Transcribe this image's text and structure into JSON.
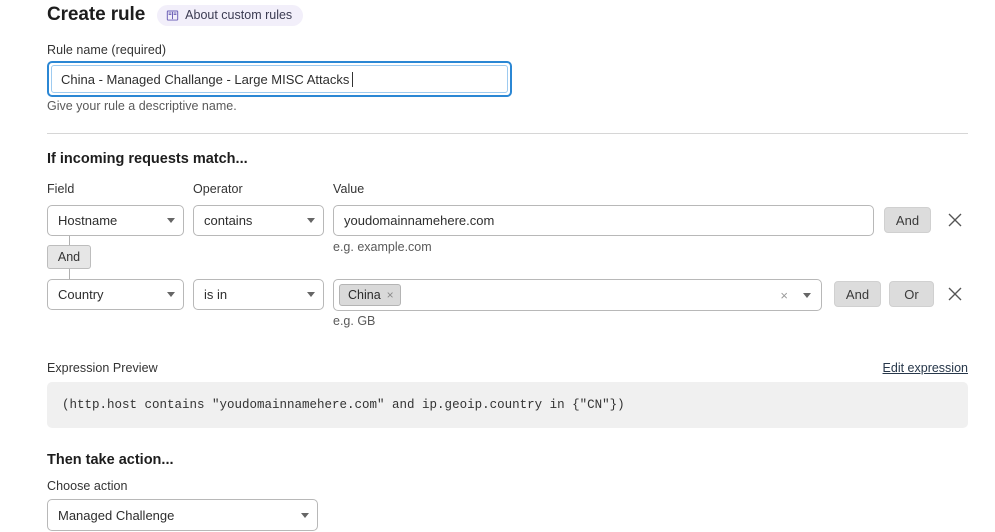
{
  "header": {
    "title": "Create rule",
    "about_pill_label": "About custom rules",
    "about_pill_icon": "book-icon",
    "pill_bg": "#f2effa",
    "pill_icon_color": "#6b5fb5"
  },
  "rule_name": {
    "label": "Rule name (required)",
    "value": "China - Managed Challange - Large MISC Attacks",
    "placeholder": "Rule name",
    "help": "Give your rule a descriptive name.",
    "focus_color": "#2b87d4"
  },
  "match_section": {
    "heading": "If incoming requests match...",
    "columns": {
      "field": "Field",
      "operator": "Operator",
      "value": "Value"
    },
    "connector_label": "And",
    "rows": [
      {
        "field": "Hostname",
        "operator": "contains",
        "value": "youdomainnamehere.com",
        "value_hint": "e.g. example.com",
        "and_label": "And",
        "or_label": null,
        "remove_label": "✕"
      },
      {
        "field": "Country",
        "operator": "is in",
        "tokens": [
          "China"
        ],
        "token_remove": "×",
        "clear_label": "×",
        "value_hint": "e.g. GB",
        "and_label": "And",
        "or_label": "Or",
        "remove_label": "✕"
      }
    ]
  },
  "expression": {
    "label": "Expression Preview",
    "edit_link": "Edit expression",
    "text": "(http.host contains \"youdomainnamehere.com\" and ip.geoip.country in {\"CN\"})"
  },
  "action_section": {
    "heading": "Then take action...",
    "choose_label": "Choose action",
    "selected_action": "Managed Challenge"
  }
}
